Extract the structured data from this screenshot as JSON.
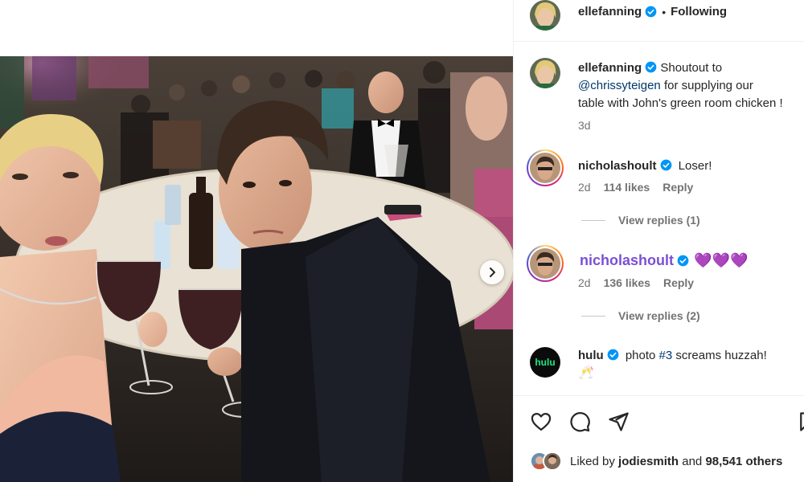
{
  "post": {
    "author": "ellefanning",
    "header_dot": "•",
    "follow_status": "Following",
    "caption": {
      "username": "ellefanning",
      "text_before": "Shoutout to",
      "mention": "@chrissyteigen",
      "text_after_line1": "for supplying our",
      "text_line3": "table with John's green room chicken !",
      "time": "3d"
    },
    "liked_by": {
      "prefix": "Liked by",
      "user": "jodiesmith",
      "conjunction": "and",
      "count": "98,541 others"
    }
  },
  "comments": [
    {
      "username": "nicholashoult",
      "text": "Loser!",
      "time": "2d",
      "likes": "114 likes",
      "reply": "Reply",
      "view_replies": "View replies (1)"
    },
    {
      "username": "nicholashoult",
      "text": "💜💜💜",
      "time": "2d",
      "likes": "136 likes",
      "reply": "Reply",
      "view_replies": "View replies (2)"
    },
    {
      "username": "hulu",
      "text_before": "photo",
      "hashtag": "#3",
      "text_after": "screams huzzah!",
      "emoji": "🥂",
      "avatar_text": "hulu"
    }
  ],
  "icons": {
    "verified": "verified-badge-icon",
    "like": "heart-icon",
    "comment": "comment-icon",
    "share": "send-icon",
    "save": "bookmark-icon",
    "next": "chevron-right-icon"
  },
  "colors": {
    "verified": "#0095f6",
    "link": "#00376b",
    "meta": "#737373",
    "hulu_bg": "#0b0b0b",
    "hulu_green": "#1ce783"
  }
}
